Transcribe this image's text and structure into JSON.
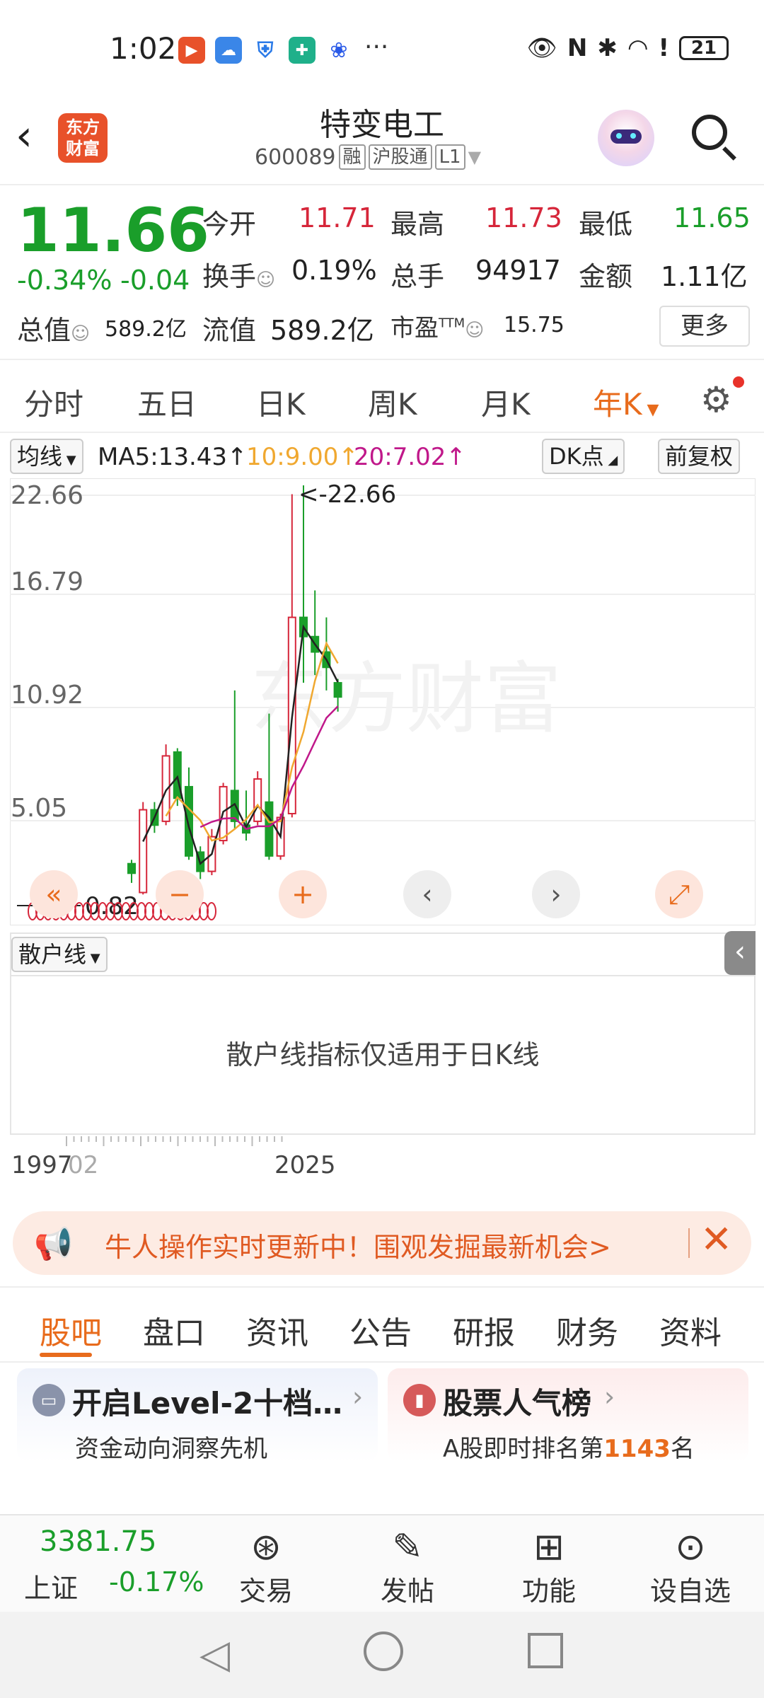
{
  "status_bar": {
    "time": "1:02",
    "battery": "21",
    "more": "···"
  },
  "header": {
    "logo_text": "东方\n财富",
    "stock_name": "特变电工",
    "stock_code": "600089",
    "tags": [
      "融",
      "沪股通",
      "L1"
    ]
  },
  "quote": {
    "price": "11.66",
    "change_pct": "-0.34%",
    "change": "-0.04",
    "rows": [
      [
        {
          "label": "今开",
          "value": "11.71",
          "color": "red"
        },
        {
          "label": "最高",
          "value": "11.73",
          "color": "red"
        },
        {
          "label": "最低",
          "value": "11.65",
          "color": "green"
        }
      ],
      [
        {
          "label": "换手",
          "value": "0.19%",
          "color": "dark"
        },
        {
          "label": "总手",
          "value": "94917",
          "color": "dark"
        },
        {
          "label": "金额",
          "value": "1.11亿",
          "color": "dark"
        }
      ]
    ],
    "row3": {
      "total_mv_label": "总值",
      "total_mv": "589.2亿",
      "float_mv_label": "流值",
      "float_mv": "589.2亿",
      "pe_label": "市盈",
      "pe_sup": "TTM",
      "pe": "15.75",
      "more_label": "更多"
    }
  },
  "period_tabs": [
    "分时",
    "五日",
    "日K",
    "周K",
    "月K",
    "年K"
  ],
  "active_period": "年K",
  "ma_bar": {
    "ma_select": "均线",
    "ma5": "MA5:13.43↑",
    "ma10": "10:9.00↑",
    "ma20": "20:7.02↑",
    "dk": "DK点",
    "adjust": "前复权"
  },
  "colors": {
    "up": "#d6263a",
    "down": "#1a9e2a",
    "ma5": "#222222",
    "ma10": "#f0a830",
    "ma20": "#c0188a",
    "accent": "#e86b1c"
  },
  "chart": {
    "y_labels": [
      "22.66",
      "16.79",
      "10.92",
      "5.05"
    ],
    "max_label": "<-22.66",
    "min_label": "0.82",
    "watermark": "东方财富",
    "x_labels": [
      "1997",
      "02",
      "2025"
    ]
  },
  "chart_data": {
    "type": "candlestick",
    "y_range": [
      0.82,
      22.66
    ],
    "candles": [
      {
        "o": 3.0,
        "h": 3.2,
        "l": 2.0,
        "c": 2.5
      },
      {
        "o": 1.5,
        "h": 6.2,
        "l": 1.4,
        "c": 5.8
      },
      {
        "o": 5.8,
        "h": 6.2,
        "l": 4.6,
        "c": 5.0
      },
      {
        "o": 5.2,
        "h": 9.2,
        "l": 5.0,
        "c": 8.6
      },
      {
        "o": 8.8,
        "h": 9.0,
        "l": 6.0,
        "c": 6.4
      },
      {
        "o": 7.0,
        "h": 8.0,
        "l": 3.2,
        "c": 3.4
      },
      {
        "o": 3.6,
        "h": 3.9,
        "l": 2.2,
        "c": 2.6
      },
      {
        "o": 2.6,
        "h": 4.8,
        "l": 2.4,
        "c": 4.4
      },
      {
        "o": 4.2,
        "h": 7.2,
        "l": 4.0,
        "c": 7.0
      },
      {
        "o": 6.8,
        "h": 12.0,
        "l": 4.8,
        "c": 5.2
      },
      {
        "o": 5.0,
        "h": 6.8,
        "l": 4.2,
        "c": 4.6
      },
      {
        "o": 5.2,
        "h": 7.8,
        "l": 5.0,
        "c": 7.4
      },
      {
        "o": 6.2,
        "h": 10.8,
        "l": 3.2,
        "c": 3.4
      },
      {
        "o": 3.4,
        "h": 5.6,
        "l": 3.2,
        "c": 5.4
      },
      {
        "o": 5.6,
        "h": 22.2,
        "l": 5.4,
        "c": 15.8
      },
      {
        "o": 15.8,
        "h": 22.66,
        "l": 12.4,
        "c": 14.8
      },
      {
        "o": 14.8,
        "h": 17.2,
        "l": 12.8,
        "c": 14.0
      },
      {
        "o": 14.0,
        "h": 15.8,
        "l": 12.0,
        "c": 13.2
      },
      {
        "o": 12.4,
        "h": 12.6,
        "l": 10.9,
        "c": 11.66
      }
    ],
    "ma5": "13.43",
    "ma10": "9.00",
    "ma20": "7.02"
  },
  "indicator": {
    "select": "散户线",
    "message": "散户线指标仅适用于日K线"
  },
  "banner": {
    "text": "牛人操作实时更新中！围观发掘最新机会>"
  },
  "content_tabs": [
    "股吧",
    "盘口",
    "资讯",
    "公告",
    "研报",
    "财务",
    "资料"
  ],
  "active_content_tab": "股吧",
  "cards": [
    {
      "title": "开启Level-2十档…",
      "subtitle": "资金动向洞察先机"
    },
    {
      "title": "股票人气榜",
      "subtitle_prefix": "A股即时排名第",
      "rank": "1143",
      "subtitle_suffix": "名"
    }
  ],
  "bottom_nav": {
    "index_value": "3381.75",
    "index_name": "上证",
    "index_change": "-0.17%",
    "items": [
      "交易",
      "发帖",
      "功能",
      "设自选"
    ]
  }
}
